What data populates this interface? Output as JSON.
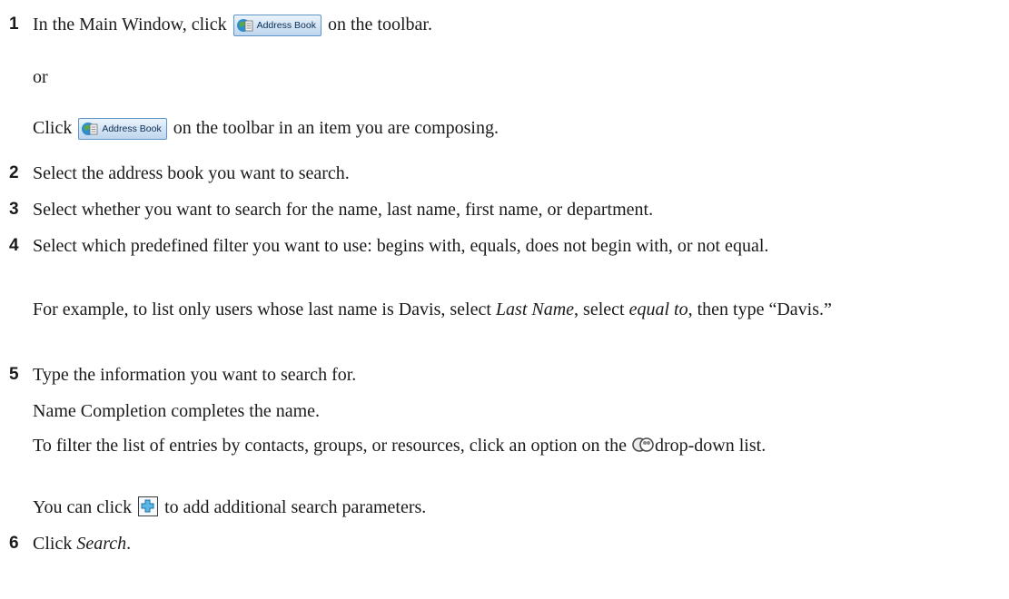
{
  "steps": [
    {
      "number": "1",
      "text_before": "In the Main Window, click",
      "button_label": "Address Book",
      "text_after": "on the toolbar."
    },
    {
      "number": "2",
      "text": "Select the address book you want to search."
    },
    {
      "number": "3",
      "text": "Select whether you want to search for the name, last name, first name, or department."
    },
    {
      "number": "4",
      "text": "Select which predefined filter you want to use: begins with, equals, does not begin with, or not equal."
    },
    {
      "number": "5",
      "text": "Type the information you want to search for."
    },
    {
      "number": "6",
      "text_before": "Click",
      "emphasis": "Search",
      "text_after": "."
    }
  ],
  "step1_or": "or",
  "step1_alt": {
    "text_before": "Click",
    "button_label": "Address Book",
    "text_after": "on the toolbar in an item you are composing."
  },
  "step4_example": {
    "part1": "For example, to list only users whose last name is Davis, select",
    "em1": "Last Name",
    "part2": ", select",
    "em2": "equal to",
    "part3": ", then type “Davis.”"
  },
  "step5_note1": "Name Completion completes the name.",
  "step5_note2": {
    "before": "To filter the list of entries by contacts, groups, or resources, click an option on the",
    "icon": "contacts-filter-icon",
    "after": "drop-down list."
  },
  "step5_note3": {
    "before": "You can click",
    "icon": "add-parameter-icon",
    "after": "to add additional search parameters."
  },
  "colors": {
    "button_border": "#5f94c6",
    "icon_blue": "#2e8fd0",
    "icon_green": "#59a848"
  }
}
